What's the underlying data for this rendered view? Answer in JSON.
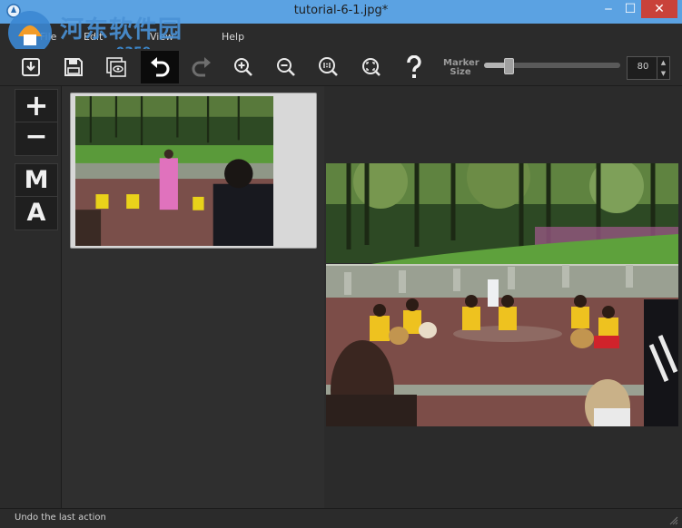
{
  "window": {
    "title": "tutorial-6-1.jpg*",
    "minimize": "‒",
    "maximize": "☐",
    "close": "✕"
  },
  "watermark": {
    "text": "河东软件园",
    "url": "www.pc0359.cn"
  },
  "menu": {
    "items": [
      "File",
      "Edit",
      "View",
      "Help"
    ]
  },
  "toolbar": {
    "buttons": [
      {
        "icon": "import-icon"
      },
      {
        "icon": "save-icon"
      },
      {
        "icon": "preview-icon"
      },
      {
        "icon": "undo-icon",
        "active": true
      },
      {
        "icon": "redo-icon"
      },
      {
        "icon": "zoom-in-icon"
      },
      {
        "icon": "zoom-out-icon"
      },
      {
        "icon": "zoom-actual-size-icon"
      },
      {
        "icon": "zoom-fit-icon"
      },
      {
        "icon": "help-icon"
      }
    ],
    "marker_size": {
      "label_line1": "Marker",
      "label_line2": "Size",
      "value": "80",
      "slider_fraction": 0.18
    }
  },
  "side_tools": {
    "plus": "+",
    "minus": "−",
    "manual": "M",
    "auto": "A"
  },
  "status": {
    "text": "Undo the last action"
  },
  "colors": {
    "titlebar": "#5ba2e2",
    "close": "#c9423a",
    "background": "#2b2b2b",
    "panel": "#2f2f2f"
  }
}
